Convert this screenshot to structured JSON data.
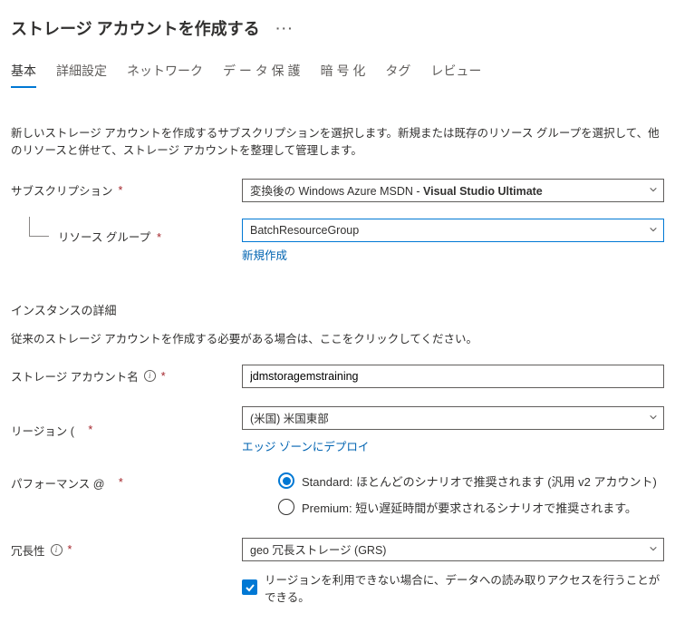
{
  "page": {
    "title": "ストレージ アカウントを作成する"
  },
  "tabs": [
    {
      "label": "基本",
      "active": true
    },
    {
      "label": "詳細設定"
    },
    {
      "label": "ネットワーク"
    },
    {
      "label": "デ ー タ 保 護"
    },
    {
      "label": "暗 号 化"
    },
    {
      "label": "タグ"
    },
    {
      "label": "レビュー"
    }
  ],
  "intro": "新しいストレージ アカウントを作成するサブスクリプションを選択します。新規または既存のリソース グループを選択して、他のリソースと併せて、ストレージ アカウントを整理して管理します。",
  "fields": {
    "subscription": {
      "label": "サブスクリプション",
      "prefix": "変換後の Windows Azure MSDN - ",
      "value": "Visual Studio Ultimate"
    },
    "resourceGroup": {
      "label": "リソース グループ",
      "value": "BatchResourceGroup",
      "createNew": "新規作成"
    },
    "instanceDetails": {
      "heading": "インスタンスの詳細",
      "subtext": "従来のストレージ アカウントを作成する必要がある場合は、ここをクリックしてください。"
    },
    "accountName": {
      "label": "ストレージ アカウント名",
      "value": "jdmstoragemstraining"
    },
    "region": {
      "label": "リージョン (",
      "value": "(米国) 米国東部",
      "edgeLink": "エッジ ゾーンにデプロイ"
    },
    "performance": {
      "label": "パフォーマンス @",
      "optionStandard": "Standard: ほとんどのシナリオで推奨されます (汎用 v2 アカウント)",
      "optionPremium": "Premium: 短い遅延時間が要求されるシナリオで推奨されます。"
    },
    "redundancy": {
      "label": "冗長性",
      "value": "geo 冗長ストレージ (GRS)",
      "checkboxLabel": "リージョンを利用できない場合に、データへの読み取りアクセスを行うことができる。"
    }
  }
}
